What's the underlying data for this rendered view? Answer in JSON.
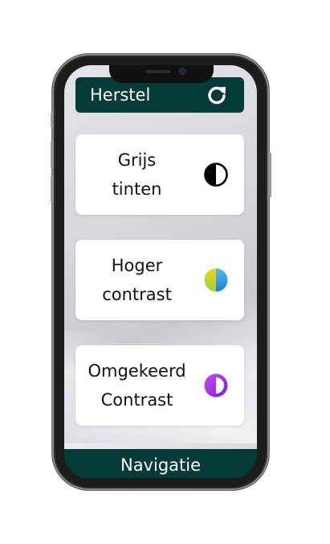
{
  "header": {
    "title": "Herstel",
    "action_icon": "refresh-icon"
  },
  "cards": [
    {
      "label": "Grijs\ntinten",
      "icon": "grayscale-icon"
    },
    {
      "label": "Hoger\ncontrast",
      "icon": "high-contrast-icon"
    },
    {
      "label": "Omgekeerd\nContrast",
      "icon": "inverted-contrast-icon"
    }
  ],
  "footer": {
    "label": "Navigatie"
  },
  "colors": {
    "bar": "#053b36",
    "card": "#ffffff"
  }
}
